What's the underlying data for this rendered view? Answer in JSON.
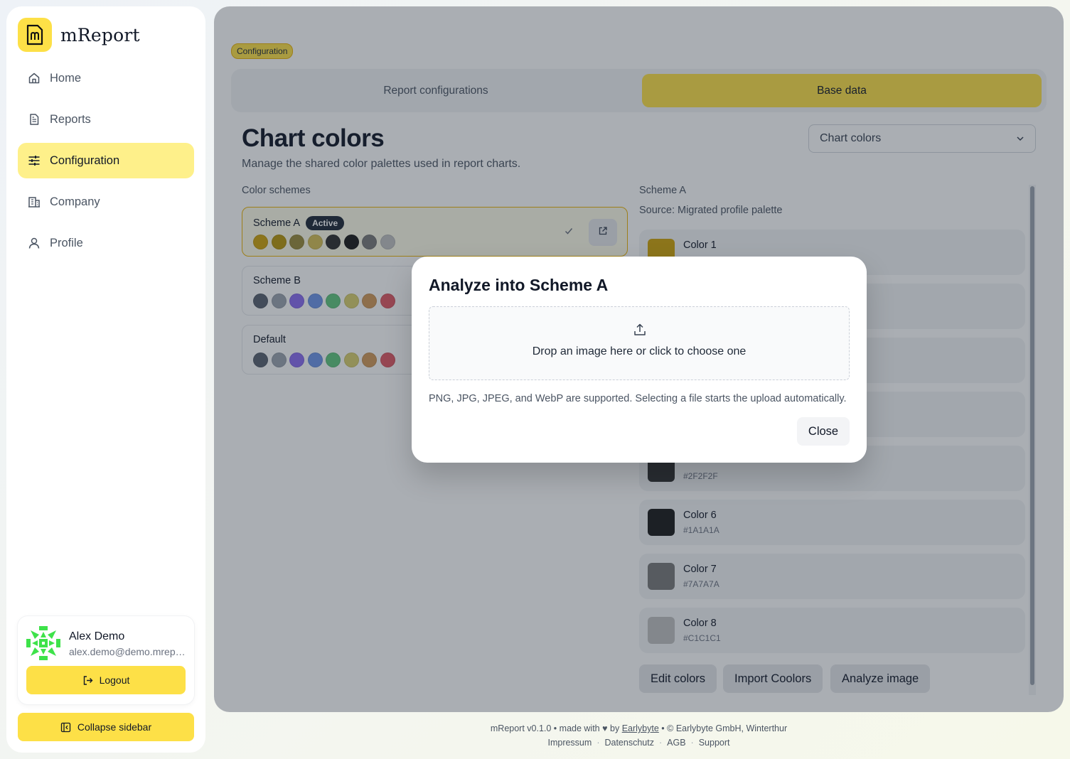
{
  "app": {
    "name": "mReport"
  },
  "sidebar": {
    "items": [
      {
        "label": "Home",
        "icon": "home-icon"
      },
      {
        "label": "Reports",
        "icon": "document-icon"
      },
      {
        "label": "Configuration",
        "icon": "sliders-icon",
        "active": true
      },
      {
        "label": "Company",
        "icon": "building-icon"
      },
      {
        "label": "Profile",
        "icon": "user-icon"
      }
    ],
    "user": {
      "name": "Alex Demo",
      "email": "alex.demo@demo.mreport.ch"
    },
    "logout_label": "Logout",
    "collapse_label": "Collapse sidebar"
  },
  "main": {
    "badge": "Configuration",
    "tabs": [
      {
        "label": "Report configurations"
      },
      {
        "label": "Base data",
        "active": true
      }
    ],
    "title": "Chart colors",
    "subtitle": "Manage the shared color palettes used in report charts.",
    "select_value": "Chart colors",
    "schemes_label": "Color schemes",
    "schemes": [
      {
        "name": "Scheme A",
        "active_badge": "Active",
        "colors": [
          "#CFA40A",
          "#B8970A",
          "#9A8B3A",
          "#D5BF55",
          "#2F2F2F",
          "#1A1A1A",
          "#7A7A7A",
          "#C1C1C1"
        ]
      },
      {
        "name": "Scheme B",
        "colors": [
          "#5A6170",
          "#9CA3AF",
          "#8B6CF0",
          "#6E95E8",
          "#62C77E",
          "#D9CF6E",
          "#D29A5A",
          "#E05A64"
        ]
      },
      {
        "name": "Default",
        "colors": [
          "#5A6170",
          "#9CA3AF",
          "#8B6CF0",
          "#6E95E8",
          "#62C77E",
          "#D9CF6E",
          "#D29A5A",
          "#E05A64"
        ]
      }
    ],
    "detail": {
      "title": "Scheme A",
      "source": "Source: Migrated profile palette",
      "colors": [
        {
          "name": "Color 1",
          "hex": "",
          "swatch": "#CFA40A"
        },
        {
          "name": "",
          "hex": "",
          "swatch": "#B8970A"
        },
        {
          "name": "",
          "hex": "",
          "swatch": "#9A8B3A"
        },
        {
          "name": "",
          "hex": "",
          "swatch": "#D5BF55"
        },
        {
          "name": "",
          "hex": "#2F2F2F",
          "swatch": "#2F2F2F"
        },
        {
          "name": "Color 6",
          "hex": "#1A1A1A",
          "swatch": "#1A1A1A"
        },
        {
          "name": "Color 7",
          "hex": "#7A7A7A",
          "swatch": "#7A7A7A"
        },
        {
          "name": "Color 8",
          "hex": "#C1C1C1",
          "swatch": "#C1C1C1"
        }
      ]
    },
    "actions": {
      "edit": "Edit colors",
      "import": "Import Coolors",
      "analyze": "Analyze image"
    }
  },
  "modal": {
    "title": "Analyze into Scheme A",
    "dropzone_text": "Drop an image here or click to choose one",
    "hint": "PNG, JPG, JPEG, and WebP are supported. Selecting a file starts the upload automatically.",
    "close_label": "Close"
  },
  "footer": {
    "line_prefix": "mReport v0.1.0 • made with ♥ by",
    "link": "Earlybyte",
    "line_suffix": "• © Earlybyte GmbH, Winterthur",
    "links": [
      "Impressum",
      "Datenschutz",
      "AGB",
      "Support"
    ]
  },
  "colors": {
    "accent": "#FDE047",
    "accent_border": "#EAB308",
    "dark": "#111827"
  }
}
